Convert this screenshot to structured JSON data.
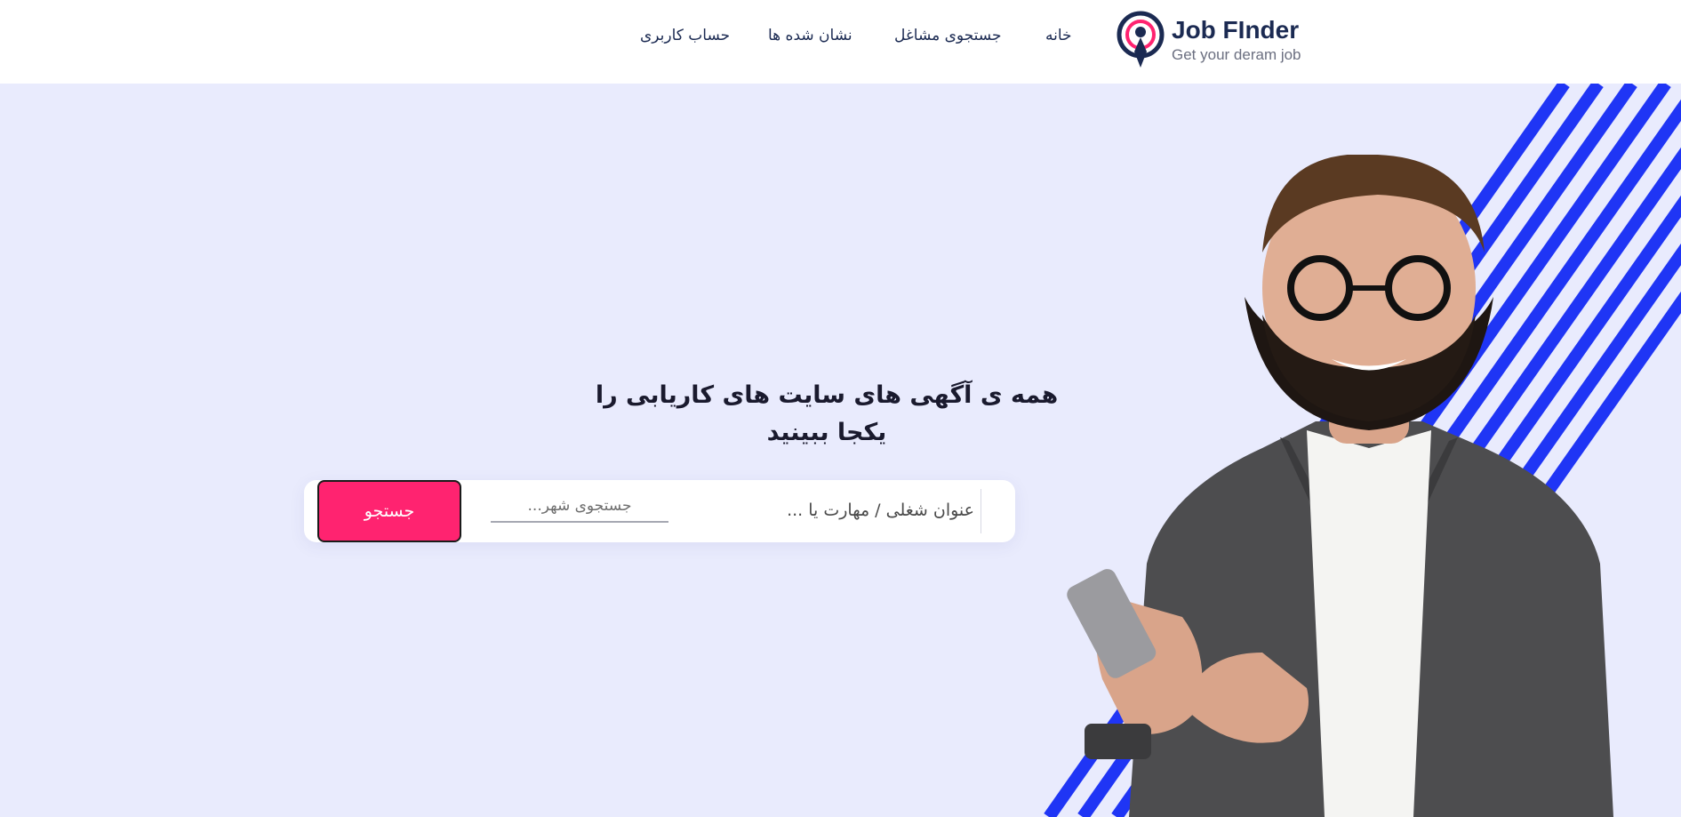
{
  "brand": {
    "name": "Job FInder",
    "tagline": "Get your deram job",
    "colors": {
      "navy": "#1b2a52",
      "pink": "#ff2370",
      "stripe_blue": "#1f35f5",
      "background": "#e9ebfd"
    }
  },
  "nav": {
    "home": "خانه",
    "job_search": "جستجوی مشاغل",
    "bookmarks": "نشان شده ها",
    "account": "حساب کاربری"
  },
  "hero": {
    "headline": "همه ی آگهی های سایت های کاریابی را یکجا ببینید",
    "search": {
      "job_placeholder": "عنوان شغلی / مهارت یا ...",
      "city_placeholder": "جستجوی شهر...",
      "button_label": "جستجو"
    },
    "image": "businessman-holding-phone"
  },
  "icons": {
    "logo": "job-finder-logo-icon"
  }
}
